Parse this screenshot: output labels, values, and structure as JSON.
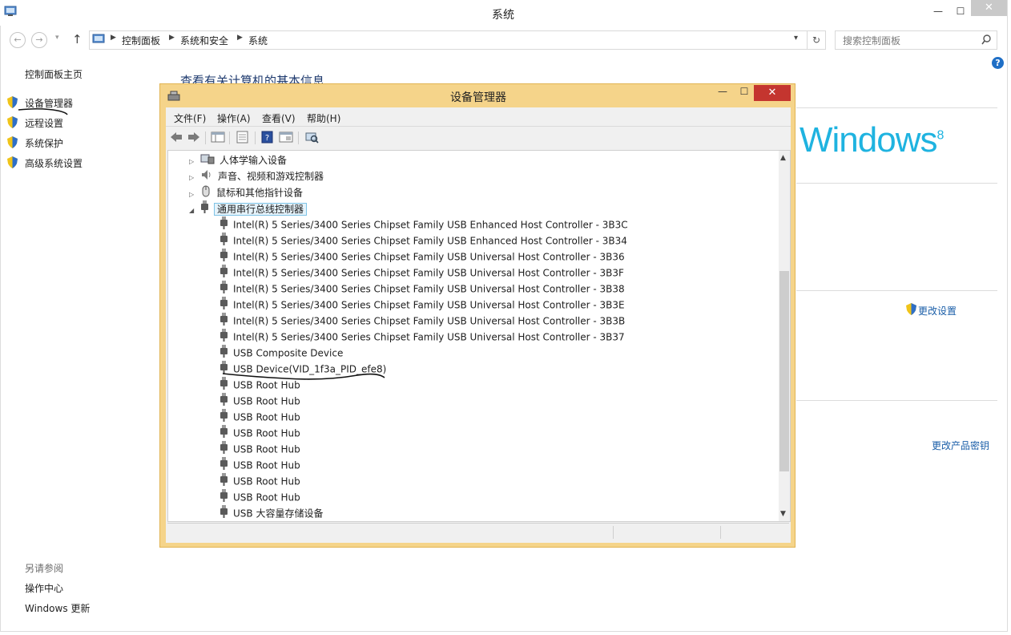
{
  "window": {
    "title": "系统",
    "minimize": "—",
    "maximize": "☐",
    "close": "✕"
  },
  "nav": {
    "back": "←",
    "forward": "→",
    "up": "↑",
    "dropdown": "▾",
    "breadcrumb": [
      "控制面板",
      "系统和安全",
      "系统"
    ],
    "search_placeholder": "搜索控制面板",
    "refresh": "↻",
    "help": "?"
  },
  "sidebar": {
    "home": "控制面板主页",
    "items": [
      {
        "label": "设备管理器"
      },
      {
        "label": "远程设置"
      },
      {
        "label": "系统保护"
      },
      {
        "label": "高级系统设置"
      }
    ],
    "see_also": {
      "heading": "另请参阅",
      "links": [
        "操作中心",
        "Windows 更新"
      ]
    }
  },
  "main": {
    "heading": "查看有关计算机的基本信息",
    "logo": {
      "text": "Windows",
      "version": "8"
    },
    "change_settings": "更改设置",
    "change_product_key": "更改产品密钥"
  },
  "device_manager": {
    "title": "设备管理器",
    "min": "—",
    "max": "☐",
    "close": "✕",
    "menu": [
      "文件(F)",
      "操作(A)",
      "查看(V)",
      "帮助(H)"
    ],
    "tree": {
      "collapsed_categories": [
        {
          "label": "人体学输入设备",
          "icon": "hid-icon"
        },
        {
          "label": "声音、视频和游戏控制器",
          "icon": "speaker-icon"
        },
        {
          "label": "鼠标和其他指针设备",
          "icon": "mouse-icon"
        }
      ],
      "expanded_category": {
        "label": "通用串行总线控制器",
        "icon": "usb-icon"
      },
      "devices": [
        "Intel(R) 5 Series/3400 Series Chipset Family USB Enhanced Host Controller - 3B3C",
        "Intel(R) 5 Series/3400 Series Chipset Family USB Enhanced Host Controller - 3B34",
        "Intel(R) 5 Series/3400 Series Chipset Family USB Universal Host Controller - 3B36",
        "Intel(R) 5 Series/3400 Series Chipset Family USB Universal Host Controller - 3B3F",
        "Intel(R) 5 Series/3400 Series Chipset Family USB Universal Host Controller - 3B38",
        "Intel(R) 5 Series/3400 Series Chipset Family USB Universal Host Controller - 3B3E",
        "Intel(R) 5 Series/3400 Series Chipset Family USB Universal Host Controller - 3B3B",
        "Intel(R) 5 Series/3400 Series Chipset Family USB Universal Host Controller - 3B37",
        "USB Composite Device",
        "USB Device(VID_1f3a_PID_efe8)",
        "USB Root Hub",
        "USB Root Hub",
        "USB Root Hub",
        "USB Root Hub",
        "USB Root Hub",
        "USB Root Hub",
        "USB Root Hub",
        "USB Root Hub",
        "USB 大容量存储设备"
      ]
    }
  },
  "colors": {
    "accent_blue": "#1a5ea8",
    "win8_logo": "#1fb3e0",
    "dm_frame": "#f5d48a",
    "close_red": "#c4352f"
  }
}
